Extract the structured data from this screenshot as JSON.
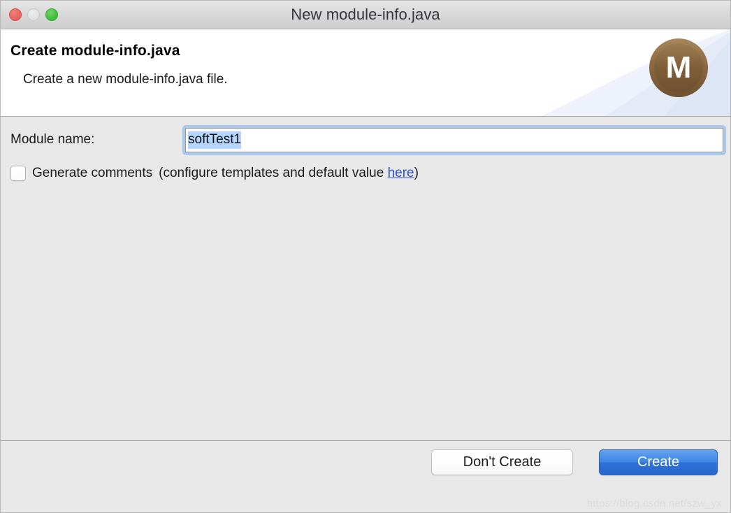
{
  "window": {
    "title": "New module-info.java",
    "traffic_lights": [
      {
        "name": "close",
        "label": "Close"
      },
      {
        "name": "minimize",
        "label": "Minimize"
      },
      {
        "name": "maximize",
        "label": "Maximize"
      }
    ]
  },
  "banner": {
    "title": "Create module-info.java",
    "subtitle": "Create a new module-info.java file.",
    "logo_glyph": "M",
    "logo_color": "#7e5f38"
  },
  "form": {
    "module_name_label": "Module name:",
    "module_name_value": "softTest1",
    "module_name_placeholder": "",
    "module_name_selected": true,
    "generate_comments": {
      "checked": false,
      "label": "Generate comments",
      "hint_prefix": "(configure templates and default value ",
      "link_text": "here",
      "hint_suffix": ")"
    }
  },
  "footer": {
    "cancel_label": "Don't Create",
    "confirm_label": "Create",
    "confirm_color": "#2f71d8"
  },
  "watermark": {
    "text": "https://blog.csdn.net/szw_yx"
  }
}
